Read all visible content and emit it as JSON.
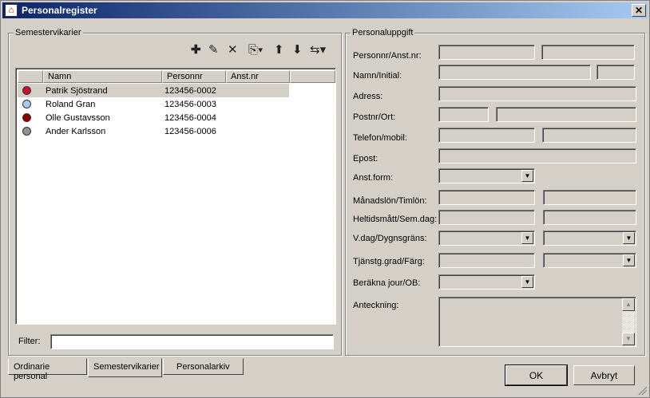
{
  "window": {
    "title": "Personalregister",
    "close_label": "✕"
  },
  "left_group": {
    "title": "Semestervikarier",
    "toolbar": [
      "plus-icon",
      "pencil-icon",
      "delete-icon",
      "copy-icon",
      "arrow-up-icon",
      "arrow-down-icon",
      "swap-icon"
    ],
    "columns": [
      "Namn",
      "Personnr",
      "Anst.nr"
    ],
    "rows": [
      {
        "name": "Patrik Sjöstrand",
        "pnr": "123456-0002",
        "anst": "",
        "color": "#c8102e",
        "selected": true
      },
      {
        "name": "Roland Gran",
        "pnr": "123456-0003",
        "anst": "",
        "color": "#a8c8f0",
        "selected": false
      },
      {
        "name": "Olle Gustavsson",
        "pnr": "123456-0004",
        "anst": "",
        "color": "#8b0000",
        "selected": false
      },
      {
        "name": "Ander Karlsson",
        "pnr": "123456-0006",
        "anst": "",
        "color": "#909090",
        "selected": false
      }
    ],
    "filter_label": "Filter:",
    "filter_value": ""
  },
  "tabs": [
    "Ordinarie personal",
    "Semestervikarier",
    "Personalarkiv"
  ],
  "right_group": {
    "title": "Personaluppgift",
    "labels": {
      "personnr": "Personnr/Anst.nr:",
      "namn": "Namn/Initial:",
      "adress": "Adress:",
      "postnr": "Postnr/Ort:",
      "telefon": "Telefon/mobil:",
      "epost": "Epost:",
      "anstform": "Anst.form:",
      "manadslon": "Månadslön/Timlön:",
      "heltid": "Heltidsmått/Sem.dag:",
      "vdag": "V.dag/Dygnsgräns:",
      "tjanstg": "Tjänstg.grad/Färg:",
      "berakna": "Beräkna jour/OB:",
      "anteckning": "Anteckning:"
    }
  },
  "buttons": {
    "ok": "OK",
    "cancel": "Avbryt"
  }
}
